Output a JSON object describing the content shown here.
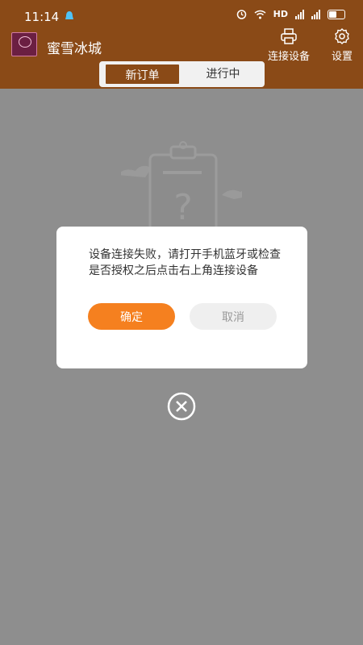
{
  "status_bar": {
    "time": "11:14",
    "network": "HD"
  },
  "header": {
    "app_title": "蜜雪冰城",
    "connect_label": "连接设备",
    "settings_label": "设置"
  },
  "tabs": [
    {
      "label": "新订单",
      "active": true
    },
    {
      "label": "进行中",
      "active": false
    }
  ],
  "dialog": {
    "message": "设备连接失败，请打开手机蓝牙或检查是否授权之后点击右上角连接设备",
    "confirm_label": "确定",
    "cancel_label": "取消"
  },
  "colors": {
    "header_bg": "#8a4a17",
    "accent": "#f5801f",
    "overlay_bg": "#8e8e8e"
  },
  "icons": [
    "notification-icon",
    "alarm-icon",
    "wifi-icon",
    "signal-icon",
    "battery-icon",
    "printer-icon",
    "gear-icon",
    "close-circle-icon"
  ]
}
